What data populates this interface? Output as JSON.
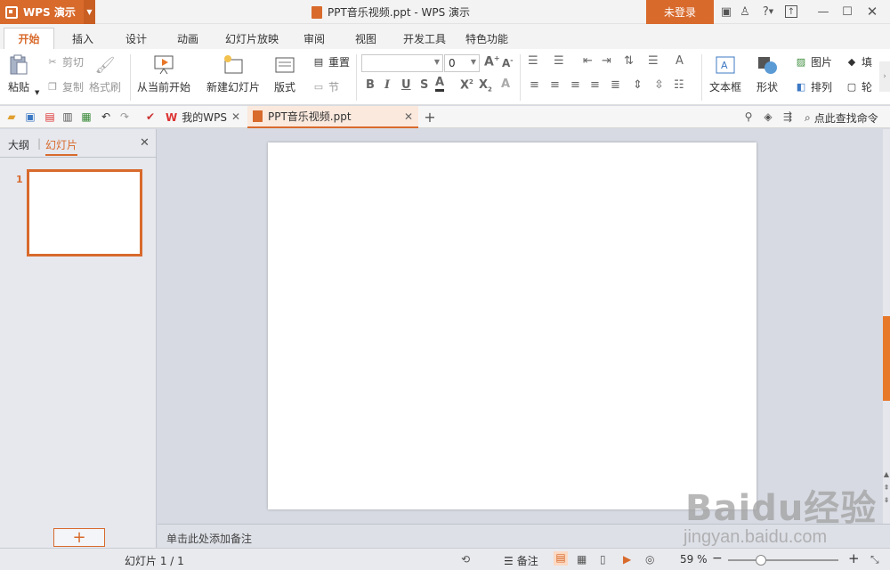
{
  "titlebar": {
    "app_name": "WPS 演示",
    "doc_title": "PPT音乐视频.ppt - WPS 演示",
    "login": "未登录",
    "help": "?",
    "icons": [
      "skin-icon",
      "shirt-icon",
      "help-icon",
      "upload-icon",
      "minimize-icon",
      "maximize-icon",
      "close-icon"
    ]
  },
  "ribbon_tabs": [
    "开始",
    "插入",
    "设计",
    "动画",
    "幻灯片放映",
    "审阅",
    "视图",
    "开发工具",
    "特色功能"
  ],
  "active_tab": "开始",
  "ribbon": {
    "paste": "粘贴",
    "cut": "剪切",
    "copy": "复制",
    "format_painter": "格式刷",
    "from_current": "从当前开始",
    "new_slide": "新建幻灯片",
    "layout": "版式",
    "reset": "重置",
    "section": "节",
    "font_name": "",
    "font_size": "0",
    "textbox": "文本框",
    "shape": "形状",
    "picture": "图片",
    "arrange": "排列",
    "fill": "填",
    "outline": "轮"
  },
  "quick_bar": {
    "tabs": [
      {
        "label": "我的WPS"
      },
      {
        "label": "PPT音乐视频.ppt"
      }
    ],
    "search": "点此查找命令"
  },
  "left_panel": {
    "outline_tab": "大纲",
    "slides_tab": "幻灯片",
    "slide_number": "1"
  },
  "notes_placeholder": "单击此处添加备注",
  "status": {
    "slide_info": "幻灯片 1 / 1",
    "notes": "备注",
    "zoom": "59 %",
    "zoom_fraction": 0.3
  },
  "watermark": {
    "logo": "Baidu经验",
    "url": "jingyan.baidu.com"
  },
  "colors": {
    "accent": "#d86a2c",
    "panel": "#e6e8ee",
    "canvas": "#d7dae2"
  }
}
